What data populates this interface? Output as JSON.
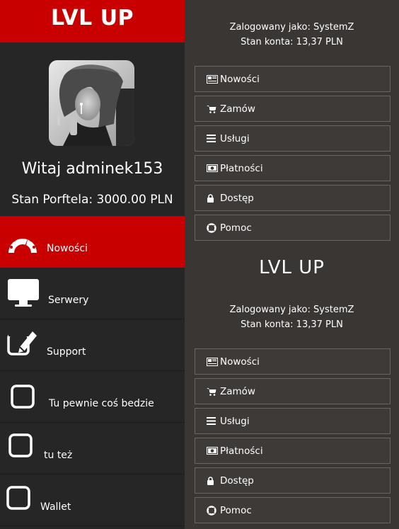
{
  "sidebar": {
    "brand": "LVL UP",
    "welcome": "Witaj adminek153",
    "balance": "Stan Porftela: 3000.00 PLN",
    "avatar_icon": "profile-photo",
    "accent_color": "#c80000",
    "items": [
      {
        "label": "Nowości",
        "icon": "speedometer-icon",
        "active": true
      },
      {
        "label": "Serwery",
        "icon": "monitor-icon",
        "active": false
      },
      {
        "label": "Support",
        "icon": "edit-icon",
        "active": false
      },
      {
        "label": "Tu pewnie coś bedzie",
        "icon": "square-icon",
        "active": false
      },
      {
        "label": "tu też",
        "icon": "square-icon",
        "active": false
      },
      {
        "label": "Wallet",
        "icon": "square-icon",
        "active": false
      }
    ]
  },
  "panel_top": {
    "logged_as": "Zalogowany jako: SystemZ",
    "account": "Stan konta: 13,37 PLN",
    "menu": [
      {
        "label": "Nowości",
        "icon": "newspaper-icon"
      },
      {
        "label": "Zamów",
        "icon": "cart-icon"
      },
      {
        "label": "Usługi",
        "icon": "list-icon"
      },
      {
        "label": "Płatności",
        "icon": "money-icon"
      },
      {
        "label": "Dostęp",
        "icon": "lock-icon"
      },
      {
        "label": "Pomoc",
        "icon": "lifebuoy-icon"
      }
    ]
  },
  "panel_bottom": {
    "title": "LVL UP",
    "logged_as": "Zalogowany jako: SystemZ",
    "account": "Stan konta: 13,37 PLN",
    "menu": [
      {
        "label": "Nowości",
        "icon": "newspaper-icon"
      },
      {
        "label": "Zamów",
        "icon": "cart-icon"
      },
      {
        "label": "Usługi",
        "icon": "list-icon"
      },
      {
        "label": "Płatności",
        "icon": "money-icon"
      },
      {
        "label": "Dostęp",
        "icon": "lock-icon"
      },
      {
        "label": "Pomoc",
        "icon": "lifebuoy-icon"
      }
    ]
  }
}
